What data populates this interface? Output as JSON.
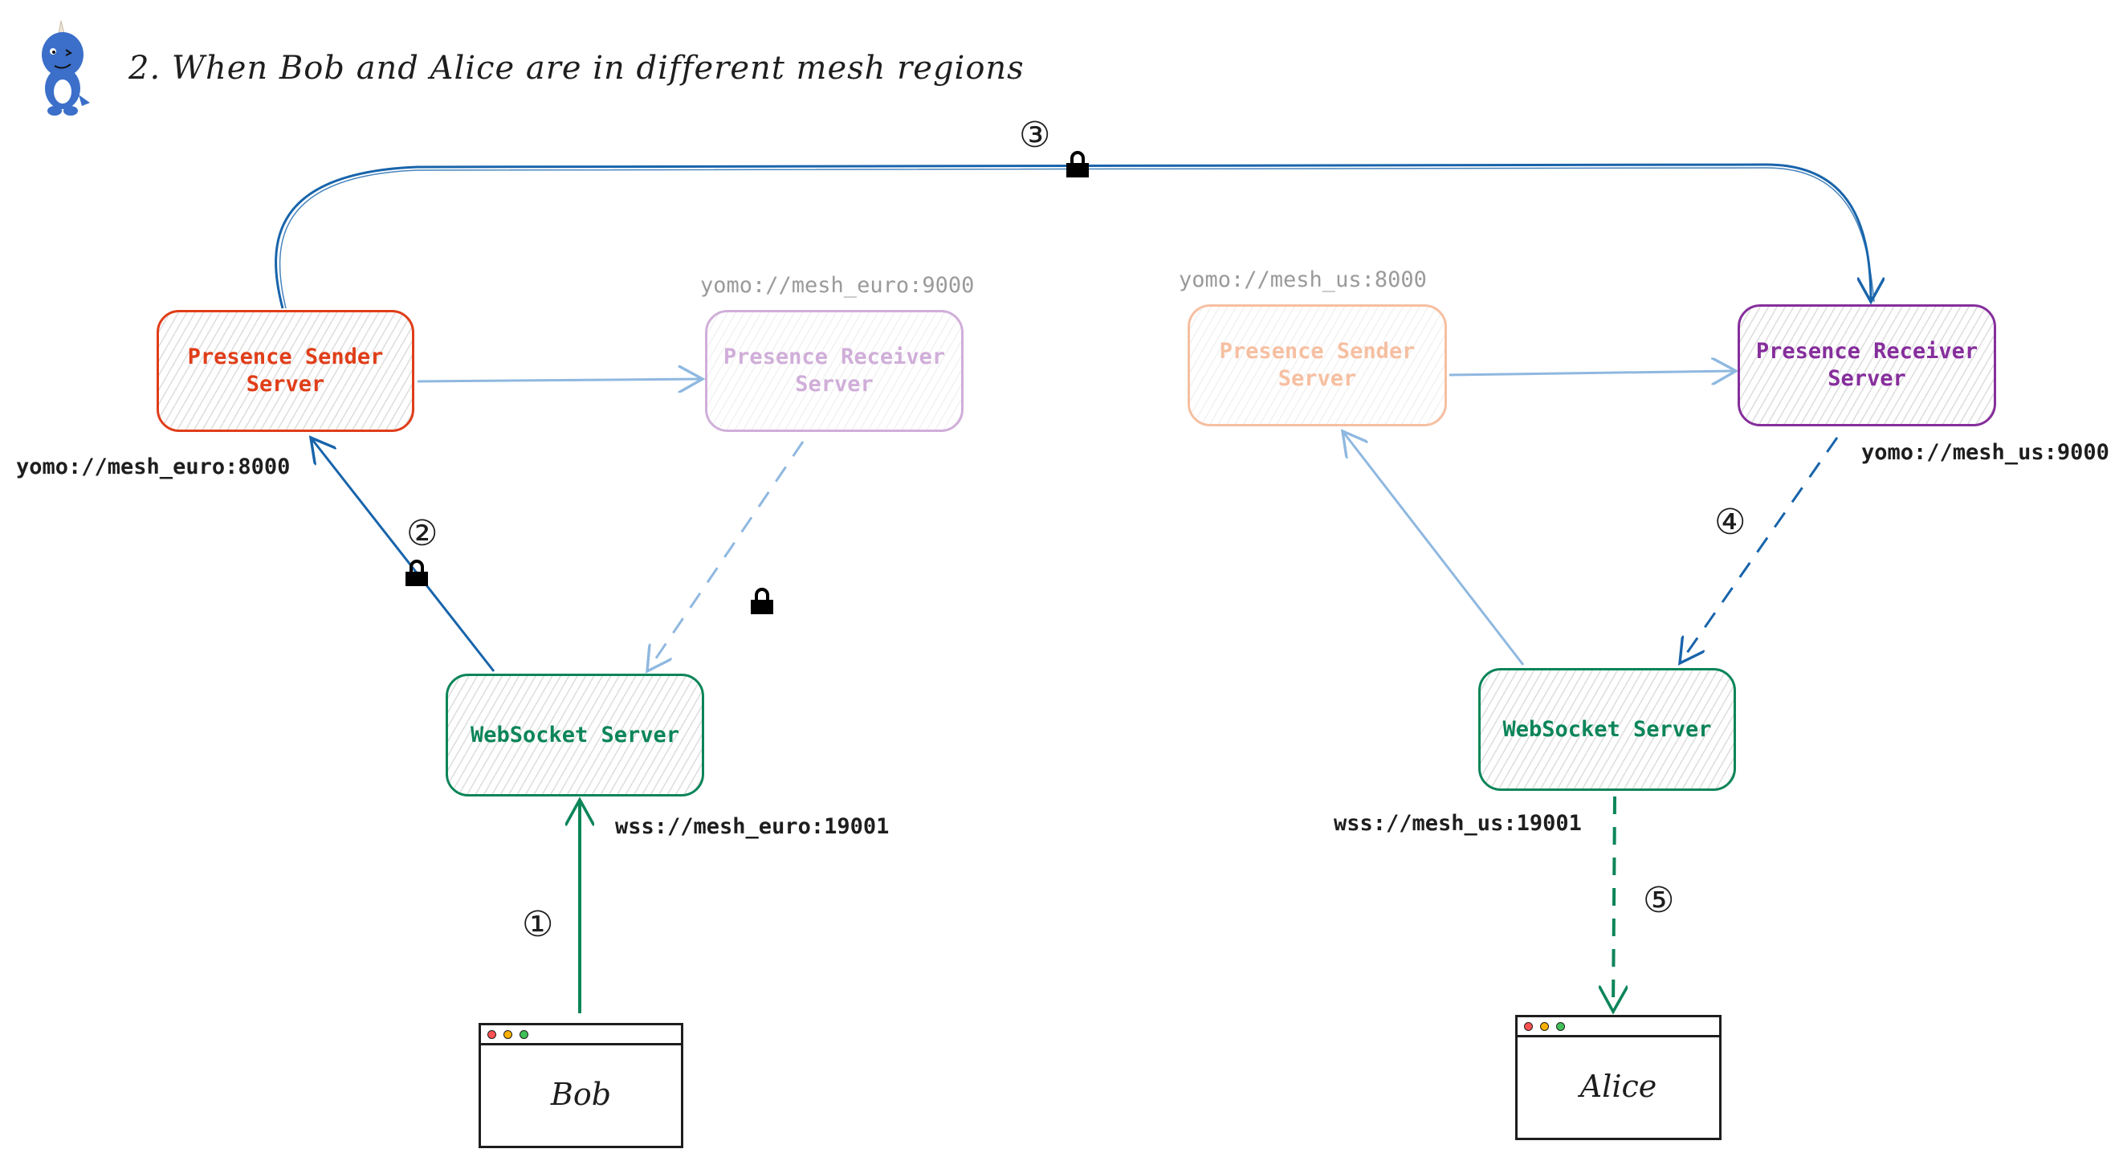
{
  "title": "2. When Bob and Alice are in different mesh regions",
  "colors": {
    "sender": "#e03e1a",
    "receiver": "#862e9c",
    "websocket": "#0c8559",
    "mesh_link": "#1864ab",
    "faded_link": "#8fb8e0",
    "dot_red": "#fa5252",
    "dot_orange": "#fab005",
    "dot_green": "#40c057"
  },
  "euro": {
    "sender": {
      "label": "Presence Sender Server",
      "address": "yomo://mesh_euro:8000"
    },
    "receiver": {
      "label": "Presence Receiver Server",
      "address": "yomo://mesh_euro:9000"
    },
    "websocket": {
      "label": "WebSocket Server",
      "address": "wss://mesh_euro:19001"
    },
    "client": {
      "label": "Bob"
    }
  },
  "us": {
    "sender": {
      "label": "Presence Sender Server",
      "address": "yomo://mesh_us:8000"
    },
    "receiver": {
      "label": "Presence Receiver Server",
      "address": "yomo://mesh_us:9000"
    },
    "websocket": {
      "label": "WebSocket Server",
      "address": "wss://mesh_us:19001"
    },
    "client": {
      "label": "Alice"
    }
  },
  "steps": [
    "①",
    "②",
    "③",
    "④",
    "⑤"
  ],
  "icons": {
    "mascot": "dinosaur-mascot-icon",
    "lock": "lock-icon"
  }
}
